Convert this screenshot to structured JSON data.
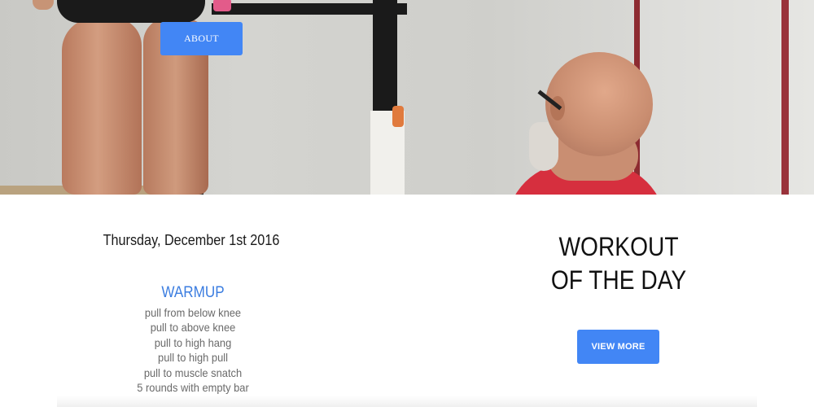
{
  "hero": {
    "about_label": "ABOUT"
  },
  "left": {
    "date": "Thursday, December 1st 2016",
    "warmup_title": "WARMUP",
    "warmup_items": [
      "pull from below knee",
      "pull to above knee",
      "pull to high hang",
      "pull to high pull",
      "pull to muscle snatch",
      "5 rounds with empty bar"
    ]
  },
  "right": {
    "wod_line1": "WORKOUT",
    "wod_line2": "OF THE DAY",
    "view_more_label": "VIEW MORE"
  },
  "colors": {
    "accent": "#4286f5",
    "warmup_heading": "#3b7de0"
  }
}
